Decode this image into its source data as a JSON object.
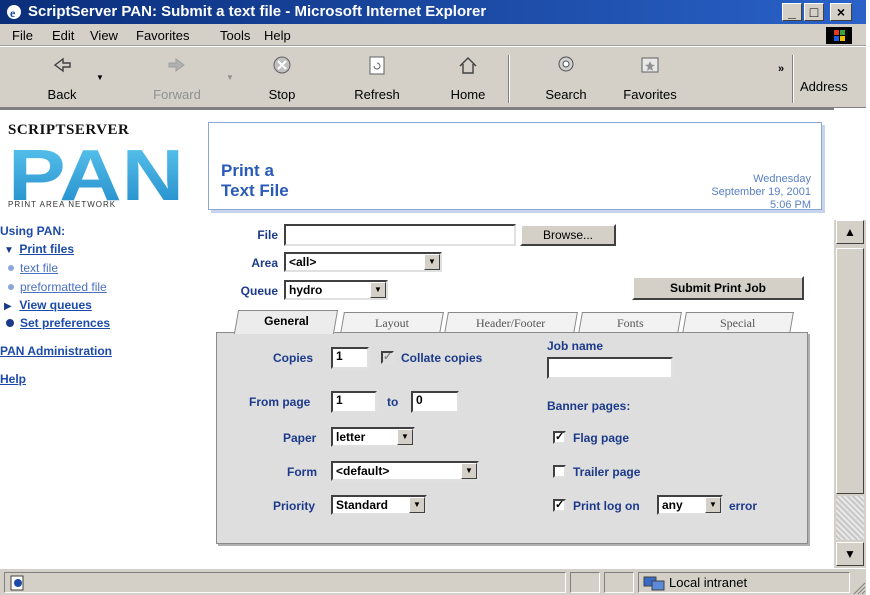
{
  "window": {
    "title": "ScriptServer PAN: Submit a text file - Microsoft Internet Explorer",
    "min": "_",
    "max": "□",
    "close": "×"
  },
  "menu": [
    "File",
    "Edit",
    "View",
    "Favorites",
    "Tools",
    "Help"
  ],
  "toolbar": {
    "back": "Back",
    "forward": "Forward",
    "stop": "Stop",
    "refresh": "Refresh",
    "home": "Home",
    "search": "Search",
    "favorites": "Favorites",
    "address": "Address",
    "more": "»"
  },
  "logo": {
    "top": "SCRIPTSERVER",
    "main": "PAN",
    "sub": "PRINT AREA NETWORK"
  },
  "header": {
    "title_line1": "Print a",
    "title_line2": "Text File",
    "day": "Wednesday",
    "date": "September 19, 2001",
    "time": "5:06 PM"
  },
  "nav": {
    "heading": "Using PAN:",
    "print_files": "Print files",
    "text_file": "text file",
    "preformatted_file": "preformatted file",
    "view_queues": "View queues",
    "set_preferences": "Set preferences",
    "admin": "PAN Administration",
    "help": "Help"
  },
  "form": {
    "file_label": "File",
    "file_value": "",
    "browse": "Browse...",
    "area_label": "Area",
    "area_value": "<all>",
    "queue_label": "Queue",
    "queue_value": "hydro",
    "submit": "Submit Print Job"
  },
  "tabs": [
    "General",
    "Layout",
    "Header/Footer",
    "Fonts",
    "Special"
  ],
  "general": {
    "copies_label": "Copies",
    "copies_value": "1",
    "collate_label": "Collate copies",
    "from_page_label": "From page",
    "from_page_value": "1",
    "to_label": "to",
    "to_value": "0",
    "paper_label": "Paper",
    "paper_value": "letter",
    "form_label": "Form",
    "form_value": "<default>",
    "priority_label": "Priority",
    "priority_value": "Standard",
    "job_name_label": "Job name",
    "job_name_value": "",
    "banner_label": "Banner pages:",
    "flag_label": "Flag page",
    "flag_checked": true,
    "trailer_label": "Trailer page",
    "trailer_checked": false,
    "printlog_label": "Print log on",
    "printlog_checked": true,
    "printlog_value": "any",
    "error_label": "error"
  },
  "status": {
    "zone": "Local intranet"
  }
}
